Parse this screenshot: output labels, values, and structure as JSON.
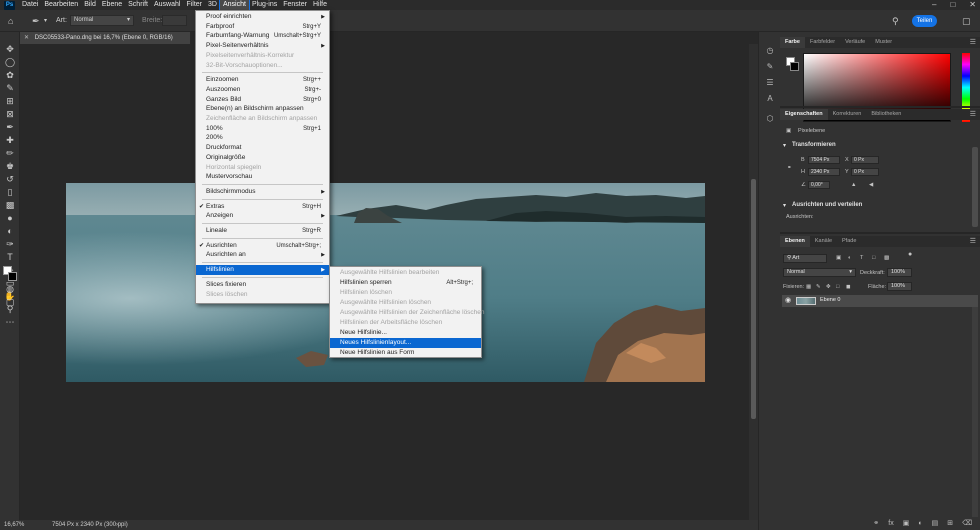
{
  "menubar": {
    "items": [
      "Datei",
      "Bearbeiten",
      "Bild",
      "Ebene",
      "Schrift",
      "Auswahl",
      "Filter",
      "3D",
      "Ansicht",
      "Plug-ins",
      "Fenster",
      "Hilfe"
    ],
    "active_index": 8
  },
  "options": {
    "mode_label": "Art:",
    "mode_value": "Normal",
    "width_label": "Breite:",
    "share_label": "Teilen"
  },
  "document": {
    "tab_title": "DSC05533-Pano.dng bei 16,7% (Ebene 0, RGB/16)",
    "zoom": "16,67%",
    "dimensions": "7504 Px x 2340 Px (300 ppi)"
  },
  "color_panel": {
    "tabs": [
      "Farbe",
      "Farbfelder",
      "Verläufe",
      "Muster"
    ]
  },
  "properties_panel": {
    "tabs": [
      "Eigenschaften",
      "Korrekturen",
      "Bibliotheken"
    ],
    "layer_kind": "Pixelebene",
    "transform_title": "Transformieren",
    "w_label": "B",
    "w_value": "7504 Px",
    "h_label": "H",
    "h_value": "2340 Px",
    "x_label": "X",
    "x_value": "0 Px",
    "y_label": "Y",
    "y_value": "0 Px",
    "angle_value": "0,00°",
    "align_title": "Ausrichten und verteilen",
    "align_label": "Ausrichten:"
  },
  "layers_panel": {
    "tabs": [
      "Ebenen",
      "Kanäle",
      "Pfade"
    ],
    "filter_value": "Art",
    "blend_mode": "Normal",
    "opacity_label": "Deckkraft:",
    "opacity_value": "100%",
    "lock_label": "Fixieren:",
    "fill_label": "Fläche:",
    "fill_value": "100%",
    "layer_name": "Ebene 0"
  },
  "ansicht_menu": {
    "items": [
      {
        "label": "Proof einrichten",
        "shortcut": "",
        "submenu": true,
        "disabled": false,
        "checked": false
      },
      {
        "label": "Farbproof",
        "shortcut": "Strg+Y",
        "submenu": false,
        "disabled": false,
        "checked": false
      },
      {
        "label": "Farbumfang-Warnung",
        "shortcut": "Umschalt+Strg+Y",
        "submenu": false,
        "disabled": false,
        "checked": false
      },
      {
        "label": "Pixel-Seitenverhältnis",
        "shortcut": "",
        "submenu": true,
        "disabled": false,
        "checked": false
      },
      {
        "label": "Pixelseitenverhältnis-Korrektur",
        "shortcut": "",
        "submenu": false,
        "disabled": true,
        "checked": false
      },
      {
        "label": "32-Bit-Vorschauoptionen...",
        "shortcut": "",
        "submenu": false,
        "disabled": true,
        "checked": false
      },
      {
        "sep": true
      },
      {
        "label": "Einzoomen",
        "shortcut": "Strg++",
        "submenu": false,
        "disabled": false,
        "checked": false
      },
      {
        "label": "Auszoomen",
        "shortcut": "Strg+-",
        "submenu": false,
        "disabled": false,
        "checked": false
      },
      {
        "label": "Ganzes Bild",
        "shortcut": "Strg+0",
        "submenu": false,
        "disabled": false,
        "checked": false
      },
      {
        "label": "Ebene(n) an Bildschirm anpassen",
        "shortcut": "",
        "submenu": false,
        "disabled": false,
        "checked": false
      },
      {
        "label": "Zeichenfläche an Bildschirm anpassen",
        "shortcut": "",
        "submenu": false,
        "disabled": true,
        "checked": false
      },
      {
        "label": "100%",
        "shortcut": "Strg+1",
        "submenu": false,
        "disabled": false,
        "checked": false
      },
      {
        "label": "200%",
        "shortcut": "",
        "submenu": false,
        "disabled": false,
        "checked": false
      },
      {
        "label": "Druckformat",
        "shortcut": "",
        "submenu": false,
        "disabled": false,
        "checked": false
      },
      {
        "label": "Originalgröße",
        "shortcut": "",
        "submenu": false,
        "disabled": false,
        "checked": false
      },
      {
        "label": "Horizontal spiegeln",
        "shortcut": "",
        "submenu": false,
        "disabled": true,
        "checked": false
      },
      {
        "label": "Mustervorschau",
        "shortcut": "",
        "submenu": false,
        "disabled": false,
        "checked": false
      },
      {
        "sep": true
      },
      {
        "label": "Bildschirmmodus",
        "shortcut": "",
        "submenu": true,
        "disabled": false,
        "checked": false
      },
      {
        "sep": true
      },
      {
        "label": "Extras",
        "shortcut": "Strg+H",
        "submenu": false,
        "disabled": false,
        "checked": true
      },
      {
        "label": "Anzeigen",
        "shortcut": "",
        "submenu": true,
        "disabled": false,
        "checked": false
      },
      {
        "sep": true
      },
      {
        "label": "Lineale",
        "shortcut": "Strg+R",
        "submenu": false,
        "disabled": false,
        "checked": false
      },
      {
        "sep": true
      },
      {
        "label": "Ausrichten",
        "shortcut": "Umschalt+Strg+;",
        "submenu": false,
        "disabled": false,
        "checked": true
      },
      {
        "label": "Ausrichten an",
        "shortcut": "",
        "submenu": true,
        "disabled": false,
        "checked": false
      },
      {
        "sep": true
      },
      {
        "label": "Hilfslinien",
        "shortcut": "",
        "submenu": true,
        "disabled": false,
        "checked": false,
        "highlight": true
      },
      {
        "sep": true
      },
      {
        "label": "Slices fixieren",
        "shortcut": "",
        "submenu": false,
        "disabled": false,
        "checked": false
      },
      {
        "label": "Slices löschen",
        "shortcut": "",
        "submenu": false,
        "disabled": true,
        "checked": false
      }
    ]
  },
  "hilfslinien_menu": {
    "items": [
      {
        "label": "Ausgewählte Hilfslinien bearbeiten",
        "shortcut": "",
        "disabled": true
      },
      {
        "label": "Hilfslinien sperren",
        "shortcut": "Alt+Strg+;",
        "disabled": false
      },
      {
        "label": "Hilfslinien löschen",
        "shortcut": "",
        "disabled": true
      },
      {
        "label": "Ausgewählte Hilfslinien löschen",
        "shortcut": "",
        "disabled": true
      },
      {
        "label": "Ausgewählte Hilfslinien der Zeichenfläche löschen",
        "shortcut": "",
        "disabled": true
      },
      {
        "label": "Hilfslinien der Arbeitsfläche löschen",
        "shortcut": "",
        "disabled": true
      },
      {
        "label": "Neue Hilfslinie...",
        "shortcut": "",
        "disabled": false
      },
      {
        "label": "Neues Hilfslinienlayout...",
        "shortcut": "",
        "disabled": false,
        "highlight": true
      },
      {
        "label": "Neue Hilfslinien aus Form",
        "shortcut": "",
        "disabled": false
      }
    ]
  }
}
